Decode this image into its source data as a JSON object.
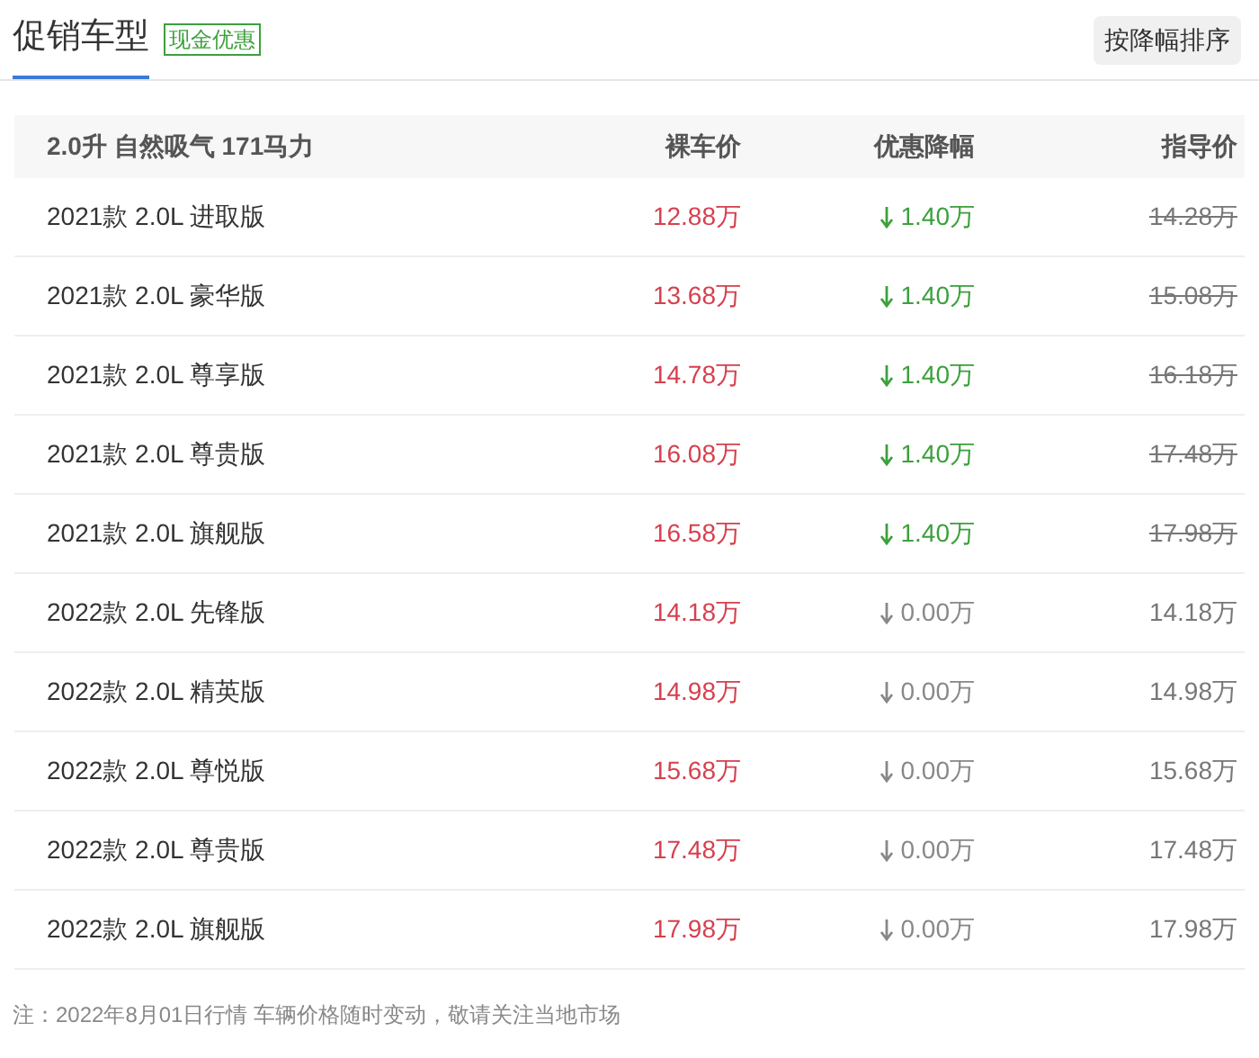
{
  "tabs": [
    {
      "label": "促销车型",
      "selected": true,
      "badge": "现金优惠"
    }
  ],
  "sort_button": "按降幅排序",
  "table": {
    "columns": [
      "2.0升 自然吸气 171马力",
      "裸车价",
      "优惠降幅",
      "指导价"
    ],
    "rows": [
      {
        "name": "2021款 2.0L 进取版",
        "price": "12.88万",
        "discount": "1.40万",
        "guide": "14.28万",
        "discounted": true
      },
      {
        "name": "2021款 2.0L 豪华版",
        "price": "13.68万",
        "discount": "1.40万",
        "guide": "15.08万",
        "discounted": true
      },
      {
        "name": "2021款 2.0L 尊享版",
        "price": "14.78万",
        "discount": "1.40万",
        "guide": "16.18万",
        "discounted": true
      },
      {
        "name": "2021款 2.0L 尊贵版",
        "price": "16.08万",
        "discount": "1.40万",
        "guide": "17.48万",
        "discounted": true
      },
      {
        "name": "2021款 2.0L 旗舰版",
        "price": "16.58万",
        "discount": "1.40万",
        "guide": "17.98万",
        "discounted": true
      },
      {
        "name": "2022款 2.0L 先锋版",
        "price": "14.18万",
        "discount": "0.00万",
        "guide": "14.18万",
        "discounted": false
      },
      {
        "name": "2022款 2.0L 精英版",
        "price": "14.98万",
        "discount": "0.00万",
        "guide": "14.98万",
        "discounted": false
      },
      {
        "name": "2022款 2.0L 尊悦版",
        "price": "15.68万",
        "discount": "0.00万",
        "guide": "15.68万",
        "discounted": false
      },
      {
        "name": "2022款 2.0L 尊贵版",
        "price": "17.48万",
        "discount": "0.00万",
        "guide": "17.48万",
        "discounted": false
      },
      {
        "name": "2022款 2.0L 旗舰版",
        "price": "17.98万",
        "discount": "0.00万",
        "guide": "17.98万",
        "discounted": false
      }
    ]
  },
  "footnote": "注：2022年8月01日行情 车辆价格随时变动，敬请关注当地市场"
}
